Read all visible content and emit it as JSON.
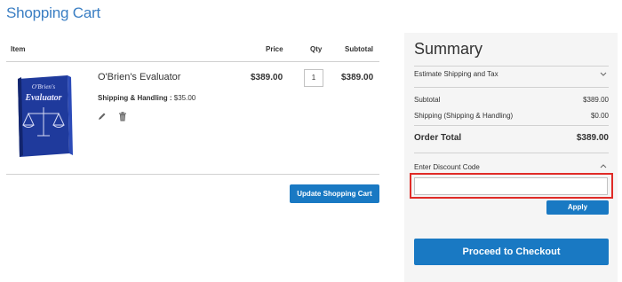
{
  "page": {
    "title": "Shopping Cart"
  },
  "cart": {
    "columns": {
      "item": "Item",
      "price": "Price",
      "qty": "Qty",
      "subtotal": "Subtotal"
    },
    "items": [
      {
        "name": "O'Brien's Evaluator",
        "image_label_line1": "O'Brien's",
        "image_label_line2": "Evaluator",
        "option_label": "Shipping & Handling :",
        "option_value": "$35.00",
        "price": "$389.00",
        "qty": "1",
        "subtotal": "$389.00",
        "edit_icon": "pencil-icon",
        "delete_icon": "trash-icon"
      }
    ],
    "update_button": "Update Shopping Cart"
  },
  "summary": {
    "title": "Summary",
    "estimate_label": "Estimate Shipping and Tax",
    "subtotal_label": "Subtotal",
    "subtotal_value": "$389.00",
    "shipping_label": "Shipping (Shipping & Handling)",
    "shipping_value": "$0.00",
    "total_label": "Order Total",
    "total_value": "$389.00",
    "discount_label": "Enter Discount Code",
    "discount_value": "",
    "discount_placeholder": "",
    "apply_button": "Apply",
    "checkout_button": "Proceed to Checkout"
  },
  "colors": {
    "accent": "#1979c3",
    "title": "#3a7ec3",
    "highlight": "#e02b27",
    "panel": "#f5f5f5",
    "book": "#1f3a9c"
  }
}
